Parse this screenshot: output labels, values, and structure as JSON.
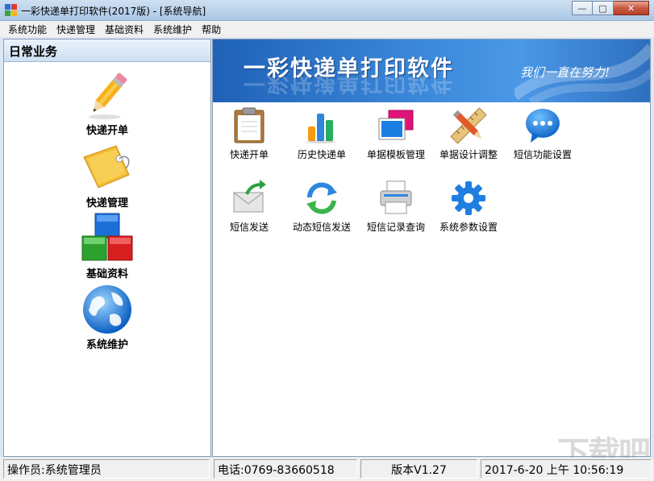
{
  "window": {
    "title": "一彩快递单打印软件(2017版) - [系统导航]",
    "buttons": {
      "minimize": "—",
      "maximize": "□",
      "close": "✕"
    }
  },
  "menu": [
    "系统功能",
    "快递管理",
    "基础资料",
    "系统维护",
    "帮助"
  ],
  "left_panel": {
    "header": "日常业务",
    "items": [
      {
        "label": "快递开单",
        "icon": "pencil-icon"
      },
      {
        "label": "快递管理",
        "icon": "tag-icon"
      },
      {
        "label": "基础资料",
        "icon": "cubes-icon"
      },
      {
        "label": "系统维护",
        "icon": "globe-icon"
      }
    ]
  },
  "banner": {
    "title": "一彩快递单打印软件",
    "slogan": "我们一直在努力!"
  },
  "tools": [
    {
      "label": "快递开单",
      "icon": "clipboard-icon"
    },
    {
      "label": "历史快递单",
      "icon": "bar-chart-icon"
    },
    {
      "label": "单据模板管理",
      "icon": "template-icon"
    },
    {
      "label": "单据设计调整",
      "icon": "pencil-ruler-icon"
    },
    {
      "label": "短信功能设置",
      "icon": "chat-bubble-icon"
    },
    {
      "label": "短信发送",
      "icon": "mail-send-icon"
    },
    {
      "label": "动态短信发送",
      "icon": "refresh-icon"
    },
    {
      "label": "短信记录查询",
      "icon": "printer-icon"
    },
    {
      "label": "系统参数设置",
      "icon": "gear-icon"
    }
  ],
  "status": {
    "operator": "操作员:系统管理员",
    "phone": "电话:0769-83660518",
    "version": "版本V1.27",
    "datetime": "2017-6-20 上午 10:56:19"
  },
  "watermark": "下载吧"
}
